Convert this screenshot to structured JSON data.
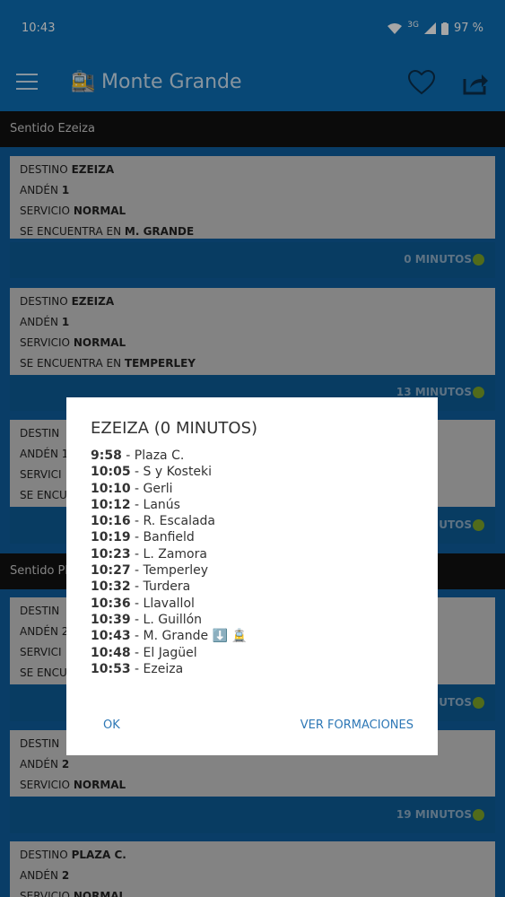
{
  "statusbar": {
    "time": "10:43",
    "network": "3G",
    "battery": "97 %"
  },
  "appbar": {
    "title": "Monte Grande",
    "train_icon": "🚉"
  },
  "sections": {
    "first": "Sentido Ezeiza",
    "second": "Sentido Pla"
  },
  "cards": [
    {
      "destino_label": "DESTINO",
      "destino": "EZEIZA",
      "anden_label": "ANDÉN",
      "anden": "1",
      "servicio_label": "SERVICIO",
      "servicio": "NORMAL",
      "ubicacion_label": "SE ENCUENTRA EN",
      "ubicacion": "M. GRANDE",
      "eta": "0 MINUTOS"
    },
    {
      "destino_label": "DESTINO",
      "destino": "EZEIZA",
      "anden_label": "ANDÉN",
      "anden": "1",
      "servicio_label": "SERVICIO",
      "servicio": "NORMAL",
      "ubicacion_label": "SE ENCUENTRA EN",
      "ubicacion": "TEMPERLEY",
      "eta": "13 MINUTOS"
    },
    {
      "destino_label": "DESTIN",
      "anden_label": "ANDÉN 1",
      "servicio_label": "SERVICI",
      "ubicacion_label": "SE ENCU",
      "eta": "UTOS"
    },
    {
      "destino_label": "DESTIN",
      "anden_label": "ANDÉN 2",
      "servicio_label": "SERVICI",
      "ubicacion_label": "SE ENCU",
      "eta": "UTOS"
    },
    {
      "destino_label": "DESTIN",
      "anden_label": "ANDÉN",
      "anden": "2",
      "servicio_label": "SERVICIO",
      "servicio": "NORMAL",
      "eta": "19 MINUTOS"
    },
    {
      "destino_label": "DESTINO",
      "destino": "PLAZA C.",
      "anden_label": "ANDÉN",
      "anden": "2",
      "servicio_label": "SERVICIO",
      "servicio": "NORMAL"
    }
  ],
  "dialog": {
    "title": "EZEIZA (0 MINUTOS)",
    "stops": [
      {
        "time": "9:58",
        "station": " - Plaza C."
      },
      {
        "time": "10:05",
        "station": " - S y Kosteki"
      },
      {
        "time": "10:10",
        "station": " - Gerli"
      },
      {
        "time": "10:12",
        "station": " - Lanús"
      },
      {
        "time": "10:16",
        "station": " - R. Escalada"
      },
      {
        "time": "10:19",
        "station": " - Banfield"
      },
      {
        "time": "10:23",
        "station": " - L. Zamora"
      },
      {
        "time": "10:27",
        "station": " - Temperley"
      },
      {
        "time": "10:32",
        "station": " - Turdera"
      },
      {
        "time": "10:36",
        "station": " - Llavallol"
      },
      {
        "time": "10:39",
        "station": " - L. Guillón"
      },
      {
        "time": "10:43",
        "station": " - M. Grande ⬇️ 🚊"
      },
      {
        "time": "10:48",
        "station": " - El Jagüel"
      },
      {
        "time": "10:53",
        "station": " - Ezeiza"
      }
    ],
    "ok_label": "OK",
    "formaciones_label": "VER FORMACIONES"
  },
  "colors": {
    "appbar": "#0d6fb5",
    "eta_dot": "#7da52a",
    "dialog_button": "#2e78b6"
  }
}
